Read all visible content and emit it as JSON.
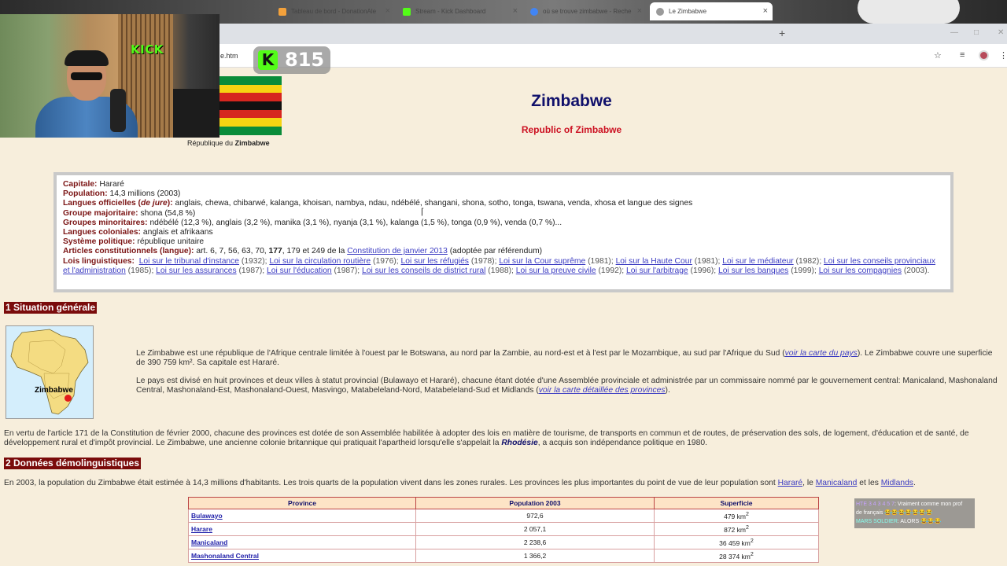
{
  "browser": {
    "tabs": [
      {
        "label": "",
        "favicon": "#888888"
      },
      {
        "label": "Tableau de bord - DonationAle",
        "favicon": "#f3a13b"
      },
      {
        "label": "Stream - Kick Dashboard",
        "favicon": "#53fc18"
      },
      {
        "label": "où se trouve zimbabwe - Reche",
        "favicon": "#4285f4"
      },
      {
        "label": "Le Zimbabwe",
        "favicon": "#9a9a9a"
      }
    ],
    "new_tab": "+",
    "url_fragment": "e.htm",
    "close_glyph": "×"
  },
  "stream": {
    "kick_logo": "KICK",
    "viewer_letter": "K",
    "viewer_count": "815",
    "chat": [
      {
        "user": "HTE 3 4 3 4 5 7",
        "msg": ": Vraiment comme mon prof"
      },
      {
        "user": "",
        "msg": "de français 😂😂😂😂😂😂😂"
      },
      {
        "user": "MARS SOLDIER",
        "msg": ": ALORS 😂😂😂"
      }
    ]
  },
  "header": {
    "flag_caption_prefix": "République du",
    "flag_caption_bold": "Zimbabwe",
    "title": "Zimbabwe",
    "subtitle": "Republic of Zimbabwe",
    "flag_colors": [
      "#0a8c3a",
      "#f6d412",
      "#d6261f",
      "#111111",
      "#d6261f",
      "#f6d412",
      "#0a8c3a"
    ]
  },
  "infobox": {
    "capitale_k": "Capitale:",
    "capitale_v": "Hararé",
    "population_k": "Population:",
    "population_v": "14,3 millions (2003)",
    "langues_k": "Langues officielles (",
    "langues_k_it": "de jure",
    "langues_k2": "):",
    "langues_v": "anglais, chewa, chibarwé, kalanga, khoisan, nambya, ndau, ndébélé, shangani, shona, sotho, tonga, tswana, venda, xhosa et langue des signes",
    "majoritaire_k": "Groupe majoritaire:",
    "majoritaire_v": "shona (54,8 %)",
    "minoritaires_k": "Groupes minoritaires:",
    "minoritaires_v": "ndébélé (12,3 %), anglais (3,2 %), manika (3,1 %), nyanja (3,1 %), kalanga (1,5 %), tonga (0,9 %), venda (0,7 %)...",
    "coloniales_k": "Langues coloniales:",
    "coloniales_v": "anglais et afrikaans",
    "systeme_k": "Système politique:",
    "systeme_v": "république unitaire",
    "articles_k": "Articles constitutionnels (langue):",
    "articles_v1": "art. 6, 7, 56, 63, 70,",
    "articles_v_bold": "177",
    "articles_v2": ", 179 et 249 de la",
    "articles_link": "Constitution de janvier 2013",
    "articles_v3": "(adoptée par référendum)",
    "lois_k": "Lois linguistiques:",
    "lois": [
      {
        "link": "Loi sur le tribunal d'instance",
        "year": " (1932); "
      },
      {
        "link": "Loi sur la circulation routière",
        "year": " (1976); "
      },
      {
        "link": "Loi sur les réfugiés",
        "year": " (1978); "
      },
      {
        "link": "Loi sur la Cour suprême",
        "year": " (1981); "
      },
      {
        "link": "Loi sur la Haute Cour",
        "year": " (1981); "
      },
      {
        "link": "Loi sur le médiateur",
        "year": " (1982); "
      },
      {
        "link": "Loi sur les conseils provinciaux et l'administration",
        "year": " (1985); "
      },
      {
        "link": "Loi sur les assurances",
        "year": " (1987); "
      },
      {
        "link": "Loi sur l'éducation",
        "year": " (1987); "
      },
      {
        "link": "Loi sur les conseils de district rural",
        "year": " (1988); "
      },
      {
        "link": "Loi sur la preuve civile",
        "year": " (1992); "
      },
      {
        "link": "Loi sur l'arbitrage",
        "year": " (1996); "
      },
      {
        "link": "Loi sur les banques",
        "year": " (1999); "
      },
      {
        "link": "Loi sur les compagnies",
        "year": " (2003)."
      }
    ]
  },
  "section1": {
    "heading": "1 Situation générale",
    "map_label": "Zimbabwe",
    "p1_a": "Le Zimbabwe est une république de l'Afrique centrale limitée à l'ouest par le Botswana, au nord par la Zambie, au nord-est et à l'est par le Mozambique, au sud par l'Afrique du Sud (",
    "p1_link": "voir la carte du pays",
    "p1_b": "). Le Zimbabwe couvre une superficie de 390 759 km². Sa capitale est Hararé.",
    "p2_a": "Le pays est divisé en huit provinces et deux villes à statut provincial (Bulawayo et Hararé), chacune étant dotée d'une Assemblée provinciale et administrée par un commissaire nommé par le gouvernement central:  Manicaland, Mashonaland Central, Mashonaland-Est, Mashonaland-Ouest, Masvingo, Matabeleland-Nord, Matabeleland-Sud et Midlands (",
    "p2_link": "voir la carte détaillée des provinces",
    "p2_b": ").",
    "p3_a": "En vertu de l'article 171 de la Constitution de février 2000, chacune des provinces est dotée de son Assemblée habilitée à adopter des lois en matière de tourisme, de transports en commun et de routes, de préservation des sols, de logement, d'éducation et de santé, de développement rural et d'impôt provincial. Le Zimbabwe, une ancienne colonie britannique qui pratiquait l'apartheid lorsqu'elle s'appelait la ",
    "p3_bold": "Rhodésie",
    "p3_b": ", a acquis son indépendance politique en 1980."
  },
  "section2": {
    "heading": "2 Données démolinguistiques",
    "p_a": "En 2003, la population du Zimbabwe était estimée à 14,3 millions d'habitants. Les trois quarts de la population vivent dans les zones rurales. Les provinces les plus importantes du point de vue de leur population sont ",
    "p_l1": "Hararé",
    "p_m1": ", le ",
    "p_l2": "Manicaland",
    "p_m2": " et les ",
    "p_l3": "Midlands",
    "p_end": ".",
    "table": {
      "headers": [
        "Province",
        "Population 2003",
        "Superficie"
      ],
      "rows": [
        {
          "province": "Bulawayo",
          "population": "972,6",
          "area": "479 km"
        },
        {
          "province": "Harare",
          "population": "2 057,1",
          "area": "872 km"
        },
        {
          "province": "Manicaland",
          "population": "2 238,6",
          "area": "36 459 km"
        },
        {
          "province": "Mashonaland Central",
          "population": "1 366,2",
          "area": "28 374 km"
        }
      ],
      "area_sup": "2"
    }
  }
}
